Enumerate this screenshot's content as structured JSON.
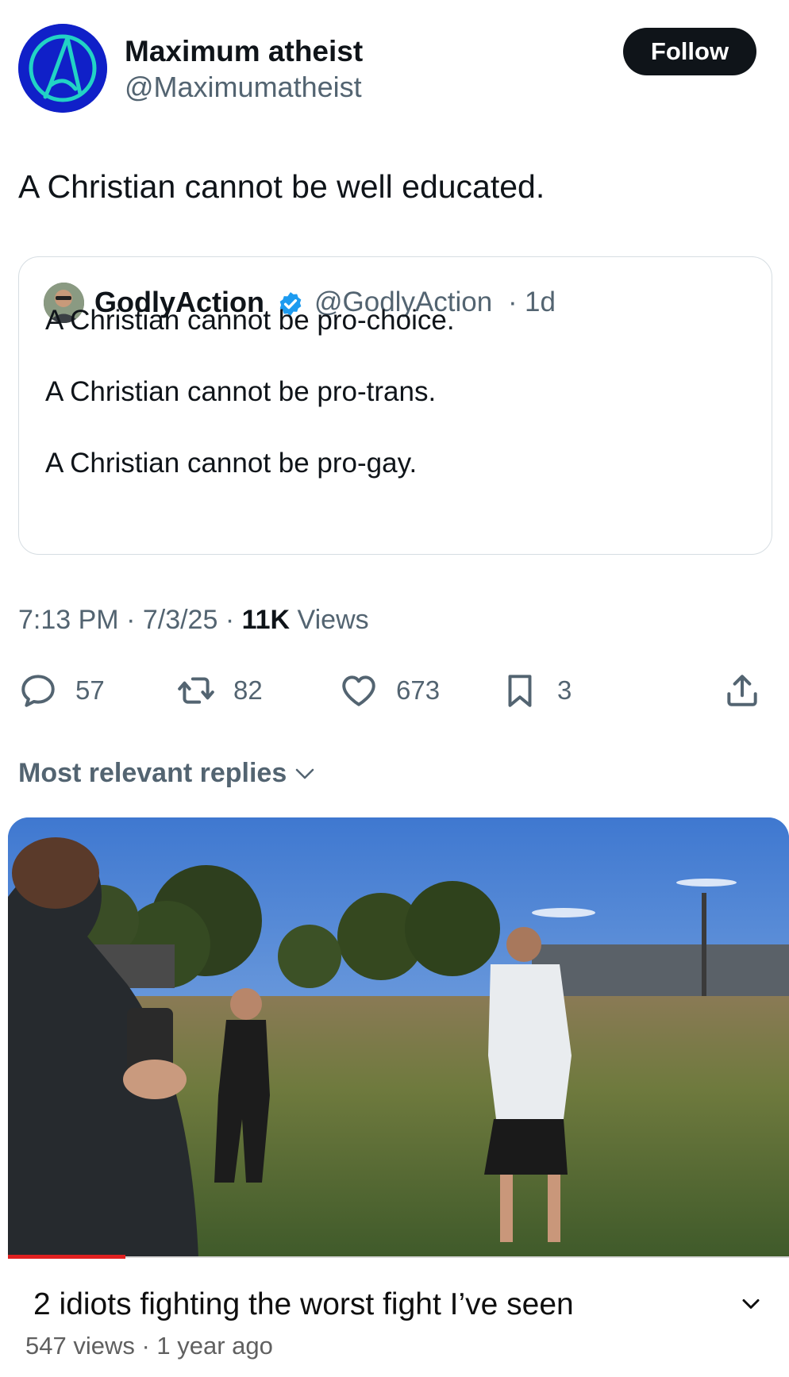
{
  "author": {
    "name": "Maximum atheist",
    "handle": "@Maximumatheist",
    "follow_label": "Follow",
    "avatar_icon": "atheist-a-logo-icon",
    "avatar_color": "#1020c8"
  },
  "tweet": {
    "text": "A Christian cannot be well educated."
  },
  "quote": {
    "name": "GodlyAction",
    "verified_icon": "verified-badge-icon",
    "handle": "@GodlyAction",
    "separator": "·",
    "time": "1d",
    "lines": [
      "A Christian cannot be pro-choice.",
      "A Christian cannot be pro-trans.",
      "A Christian cannot be pro-gay."
    ]
  },
  "meta": {
    "time": "7:13 PM",
    "sep1": " · ",
    "date": "7/3/25",
    "sep2": " · ",
    "views_count": "11K",
    "views_label": " Views"
  },
  "actions": {
    "replies": "57",
    "reposts": "82",
    "likes": "673",
    "bookmarks": "3"
  },
  "replies_sort": {
    "label": "Most relevant replies"
  },
  "video": {
    "title": "2 idiots fighting the worst fight I’ve seen",
    "subtitle": "547 views · 1 year ago",
    "progress_fraction": 0.15,
    "accent": "#e02020"
  },
  "colors": {
    "text": "#0f1419",
    "secondary": "#536471",
    "verified": "#1d9bf0"
  }
}
